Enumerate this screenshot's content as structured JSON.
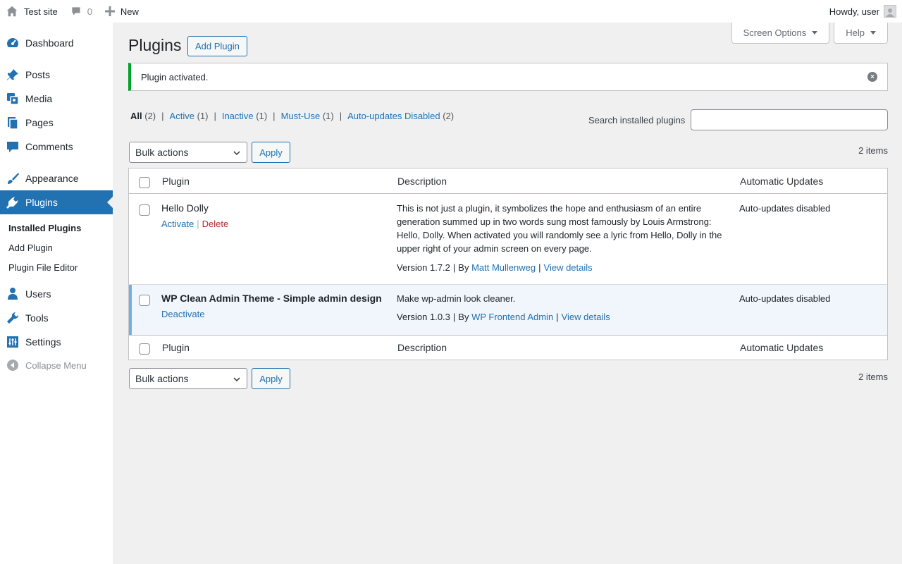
{
  "adminbar": {
    "site_name": "Test site",
    "comments_count": "0",
    "new_label": "New",
    "howdy": "Howdy, user"
  },
  "sidebar": {
    "items": [
      {
        "label": "Dashboard",
        "icon": "dashboard-icon"
      },
      {
        "label": "Posts",
        "icon": "pushpin-icon"
      },
      {
        "label": "Media",
        "icon": "media-icon"
      },
      {
        "label": "Pages",
        "icon": "pages-icon"
      },
      {
        "label": "Comments",
        "icon": "comment-icon"
      },
      {
        "label": "Appearance",
        "icon": "paintbrush-icon"
      },
      {
        "label": "Plugins",
        "icon": "plugin-icon"
      },
      {
        "label": "Users",
        "icon": "users-icon"
      },
      {
        "label": "Tools",
        "icon": "wrench-icon"
      },
      {
        "label": "Settings",
        "icon": "settings-icon"
      }
    ],
    "submenu": [
      "Installed Plugins",
      "Add Plugin",
      "Plugin File Editor"
    ],
    "collapse_label": "Collapse Menu"
  },
  "screen_meta": {
    "screen_options": "Screen Options",
    "help": "Help"
  },
  "page": {
    "title": "Plugins",
    "add_button": "Add Plugin"
  },
  "notice": {
    "text": "Plugin activated."
  },
  "filters": [
    {
      "label": "All",
      "count": "(2)"
    },
    {
      "label": "Active",
      "count": "(1)"
    },
    {
      "label": "Inactive",
      "count": "(1)"
    },
    {
      "label": "Must-Use",
      "count": "(1)"
    },
    {
      "label": "Auto-updates Disabled",
      "count": "(2)"
    }
  ],
  "filter_separator": "|",
  "search": {
    "label": "Search installed plugins",
    "value": ""
  },
  "tablenav": {
    "bulk_actions": "Bulk actions",
    "apply": "Apply",
    "items_count": "2 items"
  },
  "table": {
    "columns": [
      "Plugin",
      "Description",
      "Automatic Updates"
    ],
    "rows": [
      {
        "name": "Hello Dolly",
        "actions": [
          "Activate",
          "Delete"
        ],
        "description": "This is not just a plugin, it symbolizes the hope and enthusiasm of an entire generation summed up in two words sung most famously by Louis Armstrong: Hello, Dolly. When activated you will randomly see a lyric from Hello, Dolly in the upper right of your admin screen on every page.",
        "version": "Version 1.7.2",
        "by": "By",
        "author": "Matt Mullenweg",
        "view_details": "View details",
        "auto_updates": "Auto-updates disabled",
        "active": false
      },
      {
        "name": "WP Clean Admin Theme - Simple admin design",
        "actions": [
          "Deactivate"
        ],
        "description": "Make wp-admin look cleaner.",
        "version": "Version 1.0.3",
        "by": "By",
        "author": "WP Frontend Admin",
        "view_details": "View details",
        "auto_updates": "Auto-updates disabled",
        "active": true
      }
    ]
  },
  "colors": {
    "accent": "#2271b1",
    "success": "#00a32a",
    "delete": "#b32d2e",
    "active_row": "#f0f6fc",
    "active_border": "#72aee6"
  }
}
